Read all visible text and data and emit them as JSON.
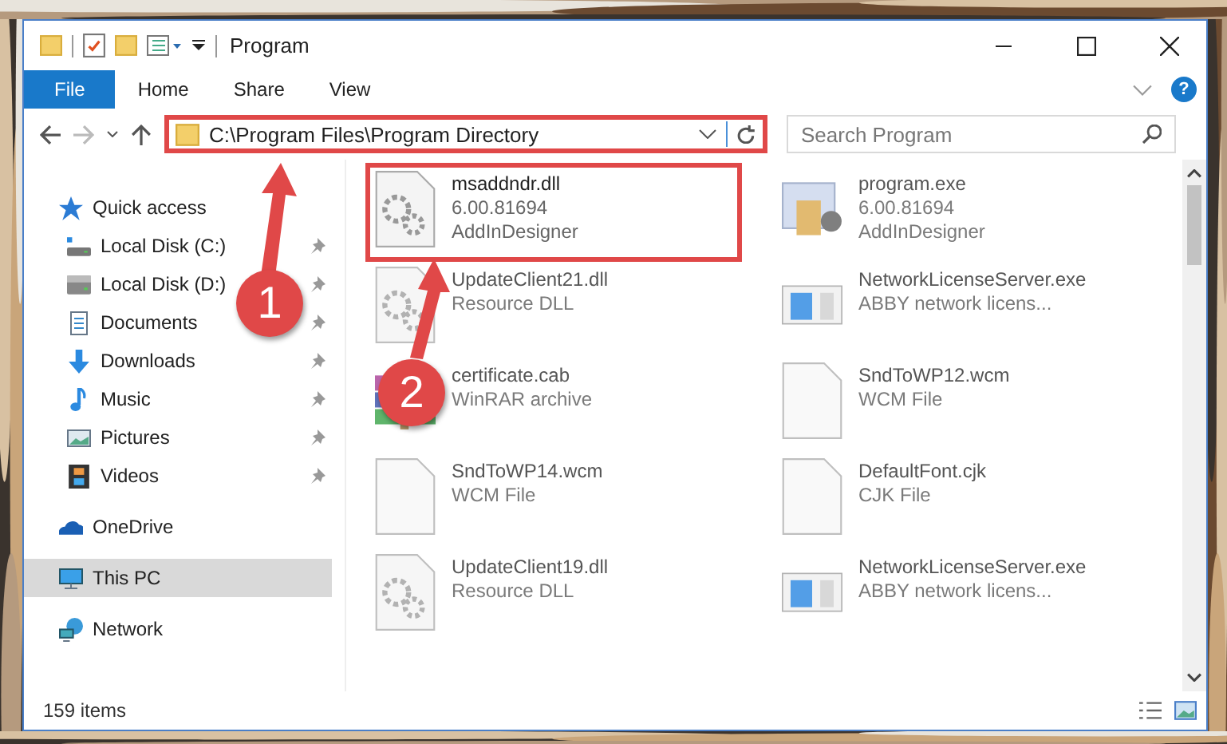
{
  "window": {
    "title": "Program",
    "ribbon_tabs": [
      {
        "label": "File",
        "selected": true
      },
      {
        "label": "Home",
        "selected": false
      },
      {
        "label": "Share",
        "selected": false
      },
      {
        "label": "View",
        "selected": false
      }
    ],
    "help": "?"
  },
  "address_bar": {
    "path": "C:\\Program Files\\Program Directory",
    "annotated": true
  },
  "search": {
    "placeholder": "Search Program"
  },
  "sidebar": {
    "items": [
      {
        "label": "Quick access",
        "kind": "star",
        "selected": false,
        "children": [
          {
            "label": "Local Disk (C:)",
            "kind": "disk-c",
            "selected": false,
            "pinned": true
          },
          {
            "label": "Local Disk (D:)",
            "kind": "disk",
            "selected": false,
            "pinned": true
          },
          {
            "label": "Documents",
            "kind": "document",
            "selected": false,
            "pinned": true
          },
          {
            "label": "Downloads",
            "kind": "download",
            "selected": false,
            "pinned": true
          },
          {
            "label": "Music",
            "kind": "music",
            "selected": false,
            "pinned": true
          },
          {
            "label": "Pictures",
            "kind": "pictures",
            "selected": false,
            "pinned": true
          },
          {
            "label": "Videos",
            "kind": "video",
            "selected": false,
            "pinned": true
          }
        ]
      },
      {
        "label": "OneDrive",
        "kind": "cloud",
        "selected": false
      },
      {
        "label": "This PC",
        "kind": "monitor",
        "selected": true
      },
      {
        "label": "Network",
        "kind": "network",
        "selected": false
      }
    ]
  },
  "files": [
    {
      "name": "msaddndr.dll",
      "details": [
        "6.00.81694",
        "AddInDesigner"
      ],
      "kind": "gears",
      "annotated": true,
      "blurred": false
    },
    {
      "name": "program.exe",
      "details": [
        "6.00.81694",
        "AddInDesigner"
      ],
      "kind": "program",
      "annotated": false,
      "blurred": true
    },
    {
      "name": "UpdateClient21.dll",
      "details": [
        "Resource DLL"
      ],
      "kind": "gears",
      "annotated": false,
      "blurred": true
    },
    {
      "name": "NetworkLicenseServer.exe",
      "details": [
        "ABBY network licens..."
      ],
      "kind": "window",
      "annotated": false,
      "blurred": true
    },
    {
      "name": "certificate.cab",
      "details": [
        "WinRAR archive"
      ],
      "kind": "archive",
      "annotated": false,
      "blurred": true
    },
    {
      "name": "SndToWP12.wcm",
      "details": [
        "WCM File"
      ],
      "kind": "blank",
      "annotated": false,
      "blurred": true
    },
    {
      "name": "SndToWP14.wcm",
      "details": [
        "WCM File"
      ],
      "kind": "blank",
      "annotated": false,
      "blurred": true
    },
    {
      "name": "DefaultFont.cjk",
      "details": [
        "CJK File"
      ],
      "kind": "blank",
      "annotated": false,
      "blurred": true
    },
    {
      "name": "UpdateClient19.dll",
      "details": [
        "Resource DLL"
      ],
      "kind": "gears",
      "annotated": false,
      "blurred": true
    },
    {
      "name": "NetworkLicenseServer.exe",
      "details": [
        "ABBY network licens..."
      ],
      "kind": "window",
      "annotated": false,
      "blurred": true
    }
  ],
  "status_bar": {
    "item_count": "159 items"
  },
  "annotations": [
    {
      "label": "1"
    },
    {
      "label": "2"
    }
  ]
}
